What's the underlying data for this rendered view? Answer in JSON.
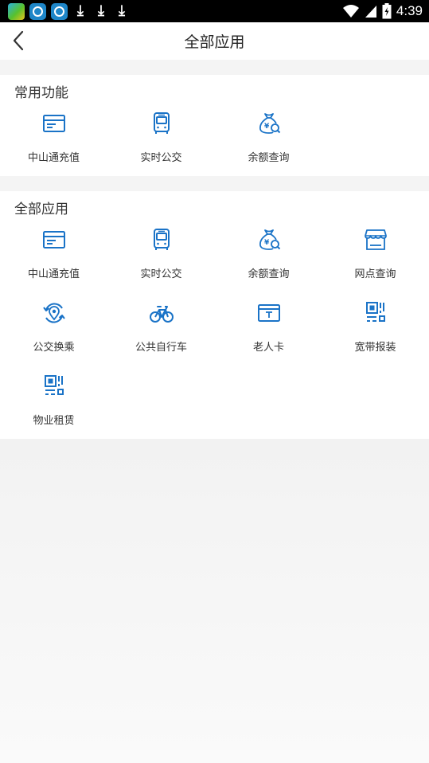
{
  "status_bar": {
    "time": "4:39",
    "icons": [
      "app-icon",
      "app-icon",
      "app-icon",
      "download-icon",
      "download-icon",
      "download-icon",
      "wifi-icon",
      "signal-icon",
      "battery-icon"
    ]
  },
  "header": {
    "title": "全部应用",
    "back_icon": "chevron-left-icon"
  },
  "common": {
    "title": "常用功能",
    "items": [
      {
        "label": "中山通充值",
        "icon": "card-icon"
      },
      {
        "label": "实时公交",
        "icon": "bus-icon"
      },
      {
        "label": "余额查询",
        "icon": "money-bag-search-icon"
      }
    ]
  },
  "all": {
    "title": "全部应用",
    "items": [
      {
        "label": "中山通充值",
        "icon": "card-icon"
      },
      {
        "label": "实时公交",
        "icon": "bus-icon"
      },
      {
        "label": "余额查询",
        "icon": "money-bag-search-icon"
      },
      {
        "label": "网点查询",
        "icon": "store-icon"
      },
      {
        "label": "公交换乘",
        "icon": "transfer-location-icon"
      },
      {
        "label": "公共自行车",
        "icon": "bicycle-icon"
      },
      {
        "label": "老人卡",
        "icon": "elder-card-icon"
      },
      {
        "label": "宽带报装",
        "icon": "qr-code-icon"
      },
      {
        "label": "物业租赁",
        "icon": "qr-code-icon"
      }
    ]
  },
  "colors": {
    "accent": "#1a73c7",
    "background": "#f4f4f4",
    "status_bar": "#000000"
  }
}
